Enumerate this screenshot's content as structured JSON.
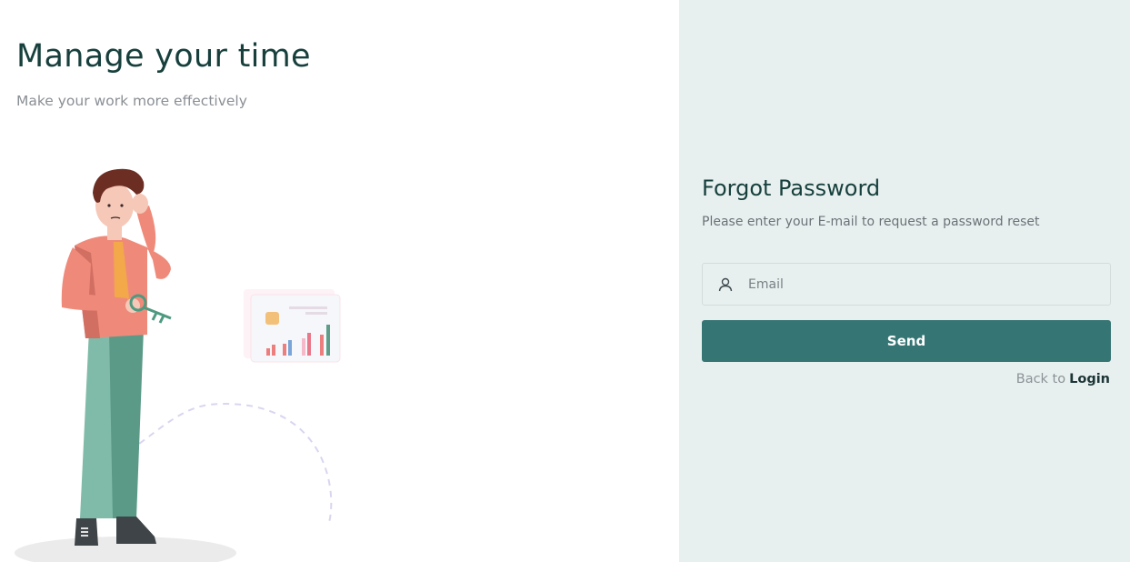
{
  "hero": {
    "title": "Manage your time",
    "subtitle": "Make your work more effectively"
  },
  "form": {
    "title": "Forgot Password",
    "subtitle": "Please enter your E-mail to request a password reset",
    "email_placeholder": "Email",
    "email_value": "",
    "send_label": "Send",
    "back_text": "Back to",
    "login_label": "Login"
  },
  "icons": {
    "email_field": "user-icon"
  },
  "colors": {
    "brand": "#357574",
    "heading": "#17403d",
    "panel_bg": "#e8f0ef"
  }
}
